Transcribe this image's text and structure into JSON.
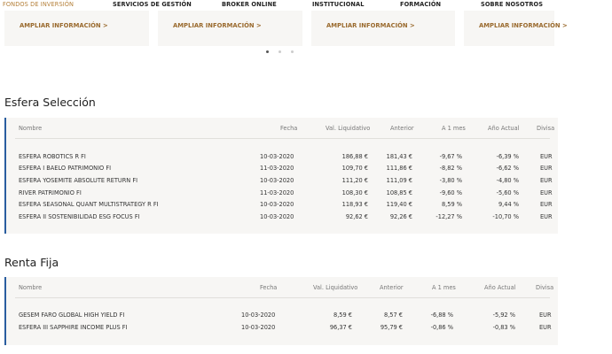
{
  "nav": {
    "items": [
      {
        "label": "FONDOS DE INVERSIÓN",
        "active": true
      },
      {
        "label": "SERVICIOS DE GESTIÓN",
        "active": false
      },
      {
        "label": "BROKER ONLINE",
        "active": false
      },
      {
        "label": "INSTITUCIONAL",
        "active": false
      },
      {
        "label": "FORMACIÓN",
        "active": false
      },
      {
        "label": "SOBRE NOSOTROS",
        "active": false
      }
    ]
  },
  "cards": {
    "link_label": "AMPLIAR INFORMACIÓN >",
    "items": [
      {
        "link": "AMPLIAR INFORMACIÓN >"
      },
      {
        "link": "AMPLIAR INFORMACIÓN >"
      },
      {
        "link": "AMPLIAR INFORMACIÓN >"
      },
      {
        "link": "AMPLIAR INFORMACIÓN >"
      }
    ]
  },
  "carousel": {
    "pages": 3,
    "active_index": 0
  },
  "sections": [
    {
      "title": "Esfera Selección",
      "headers": [
        "Nombre",
        "Fecha",
        "Val. Liquidativo",
        "Anterior",
        "A 1 mes",
        "Año Actual",
        "Divisa"
      ],
      "rows": [
        [
          "ESFERA ROBOTICS R FI",
          "10-03-2020",
          "186,88 €",
          "181,43 €",
          "-9,67 %",
          "-6,39 %",
          "EUR"
        ],
        [
          "ESFERA I BAELO PATRIMONIO FI",
          "11-03-2020",
          "109,70 €",
          "111,86 €",
          "-8,82 %",
          "-6,62 %",
          "EUR"
        ],
        [
          "ESFERA YOSEMITE ABSOLUTE RETURN FI",
          "10-03-2020",
          "111,20 €",
          "111,09 €",
          "-3,80 %",
          "-4,80 %",
          "EUR"
        ],
        [
          "RIVER PATRIMONIO FI",
          "11-03-2020",
          "108,30 €",
          "108,85 €",
          "-9,60 %",
          "-5,60 %",
          "EUR"
        ],
        [
          "ESFERA SEASONAL QUANT MULTISTRATEGY R FI",
          "10-03-2020",
          "118,93 €",
          "119,40 €",
          "8,59 %",
          "9,44 %",
          "EUR"
        ],
        [
          "ESFERA II SOSTENIBILIDAD ESG FOCUS FI",
          "10-03-2020",
          "92,62 €",
          "92,26 €",
          "-12,27 %",
          "-10,70 %",
          "EUR"
        ]
      ]
    },
    {
      "title": "Renta Fija",
      "headers": [
        "Nombre",
        "Fecha",
        "Val. Liquidativo",
        "Anterior",
        "A 1 mes",
        "Año Actual",
        "Divisa"
      ],
      "rows": [
        [
          "GESEM FARO GLOBAL HIGH YIELD FI",
          "10-03-2020",
          "8,59 €",
          "8,57 €",
          "-6,88 %",
          "-5,92 %",
          "EUR"
        ],
        [
          "ESFERA III SAPPHIRE INCOME PLUS FI",
          "10-03-2020",
          "96,37 €",
          "95,79 €",
          "-0,86 %",
          "-0,83 %",
          "EUR"
        ]
      ]
    }
  ],
  "colors": {
    "accent": "#b5803a",
    "table_border": "#2a5d9f",
    "table_bg": "#f7f6f4"
  }
}
